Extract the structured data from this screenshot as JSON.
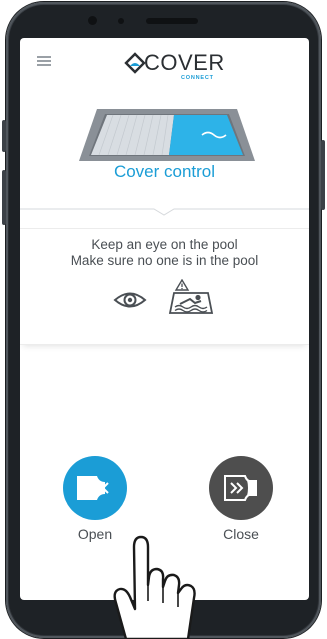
{
  "app": {
    "logo_text": "COVER",
    "logo_subtext": "CONNECT"
  },
  "header": {
    "menu_icon": "hamburger-menu-icon"
  },
  "main": {
    "section_title": "Cover control",
    "safety": {
      "line1": "Keep an eye on the pool",
      "line2": "Make sure no one is in the pool",
      "icons": [
        "eye-icon",
        "swimmer-warning-icon"
      ]
    },
    "controls": {
      "open_label": "Open",
      "close_label": "Close"
    }
  },
  "colors": {
    "accent": "#1b9dd6",
    "close_button": "#4e4e4e",
    "text": "#4a4f54"
  }
}
